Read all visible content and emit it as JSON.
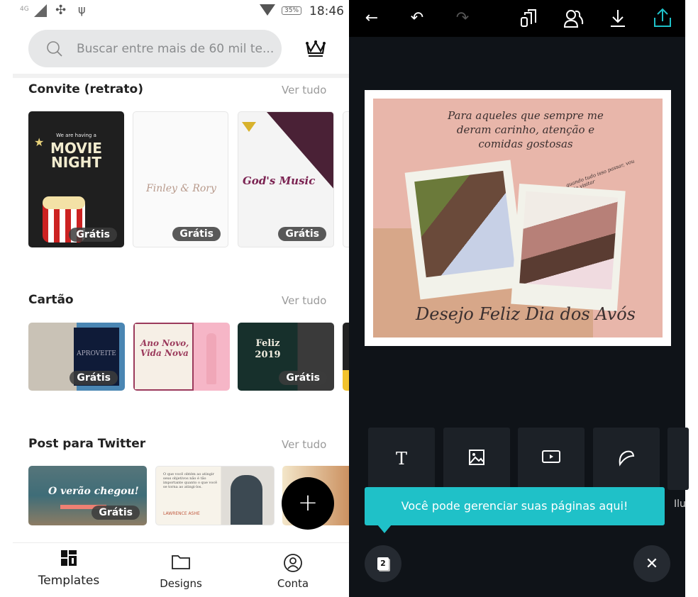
{
  "status_bar": {
    "network": "4G",
    "battery": "35%",
    "time": "18:46"
  },
  "search": {
    "placeholder": "Buscar entre mais de 60 mil te..."
  },
  "sections": [
    {
      "title": "Convite (retrato)",
      "see_all": "Ver tudo",
      "cards": [
        {
          "text": "MOVIE NIGHT",
          "sub": "We are having a",
          "badge": "Grátis"
        },
        {
          "text": "Finley & Rory",
          "badge": "Grátis"
        },
        {
          "text": "God's Music",
          "badge": "Grátis"
        }
      ]
    },
    {
      "title": "Cartão",
      "see_all": "Ver tudo",
      "cards": [
        {
          "text": "APROVEITE",
          "badge": "Grátis"
        },
        {
          "text": "Ano Novo, Vida Nova"
        },
        {
          "text": "Feliz 2019",
          "badge": "Grátis"
        }
      ]
    },
    {
      "title": "Post para Twitter",
      "see_all": "Ver tudo",
      "cards": [
        {
          "text": "O verão chegou!",
          "badge": "Grátis"
        },
        {
          "text": "O que você obtém ao atingir seus objetivos não é tão importante quanto o que você se torna ao atingi-los.",
          "sub": "LAWRENCE ASHE"
        },
        {
          "text": ""
        }
      ]
    }
  ],
  "fab": {
    "label": "+"
  },
  "bottom_nav": [
    {
      "label": "Templates",
      "icon": "templates-icon"
    },
    {
      "label": "Designs",
      "icon": "folder-icon"
    },
    {
      "label": "Conta",
      "icon": "account-icon"
    }
  ],
  "editor": {
    "canvas": {
      "line1": "Para aqueles que sempre me deram carinho, atenção e comidas gostosas",
      "note": "quando tudo isso passar, vou ai te visitar",
      "title": "Desejo Feliz Dia dos Avós"
    },
    "tools": [
      {
        "icon": "text-icon",
        "glyph": "T"
      },
      {
        "icon": "image-icon"
      },
      {
        "icon": "video-icon"
      },
      {
        "icon": "sticker-icon"
      }
    ],
    "partial_tool_label": "Ilu",
    "tooltip": "Você pode gerenciar suas páginas aqui!",
    "page_count": "2",
    "colors": {
      "accent": "#1fc1c8",
      "background": "#0f1318"
    }
  }
}
